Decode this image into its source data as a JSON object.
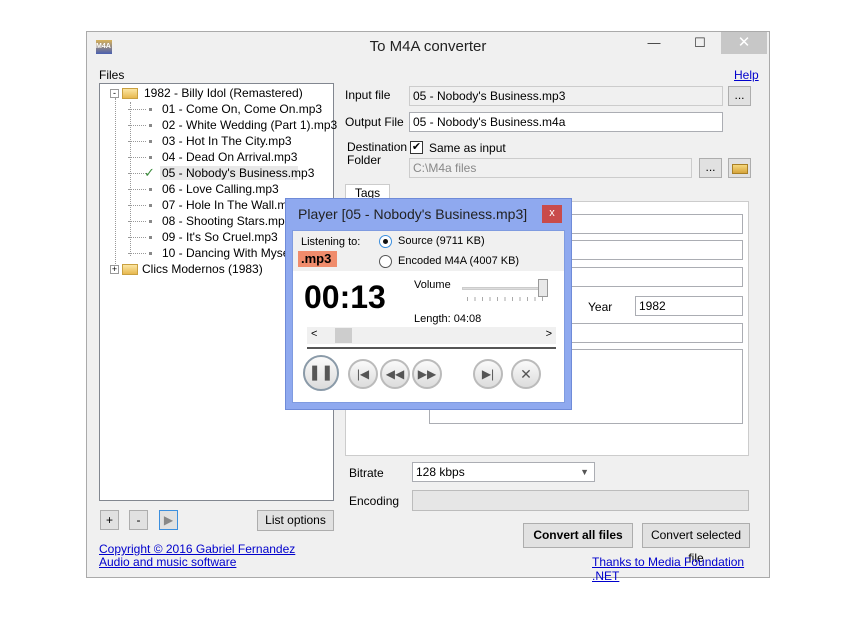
{
  "window": {
    "title": "To M4A converter",
    "minimize": "—",
    "maximize": "☐",
    "close": "✕"
  },
  "files_label": "Files",
  "help_link": "Help",
  "tree": {
    "albums": [
      {
        "label": "1982 - Billy Idol (Remastered)",
        "expanded": true,
        "tracks": [
          "01 - Come On, Come On.mp3",
          "02 - White Wedding (Part 1).mp3",
          "03 - Hot In The City.mp3",
          "04 - Dead On Arrival.mp3",
          "05 - Nobody's Business.mp3",
          "06 - Love Calling.mp3",
          "07 - Hole In The Wall.mp3",
          "08 - Shooting Stars.mp3",
          "09 - It's So Cruel.mp3",
          "10 - Dancing With Myself."
        ]
      },
      {
        "label": "Clics Modernos (1983)",
        "expanded": false
      }
    ],
    "selected_track": "05 - Nobody's Business.mp3"
  },
  "list_buttons": {
    "add": "+",
    "remove": "-",
    "play": "▶",
    "options": "List options"
  },
  "form": {
    "input_file_label": "Input file",
    "input_file": "05 - Nobody's Business.mp3",
    "output_file_label": "Output File",
    "output_file": "05 - Nobody's Business.m4a",
    "dest_label_1": "Destination",
    "dest_label_2": "Folder",
    "same_as_input_label": "Same as input",
    "same_as_input": true,
    "dest_folder": "C:\\M4a files",
    "browse": "...",
    "tags_tab": "Tags",
    "year_label": "Year",
    "year": "1982",
    "bitrate_label": "Bitrate",
    "bitrate": "128 kbps",
    "encoding_label": "Encoding",
    "encoding_progress": 0
  },
  "actions": {
    "convert_all": "Convert all files",
    "convert_selected": "Convert selected file"
  },
  "footer": {
    "copyright": "Copyright ©  2016 Gabriel Fernandez",
    "software": "Audio and music software",
    "thanks": "Thanks to Media Foundation .NET"
  },
  "player": {
    "title": "Player [05 - Nobody's Business.mp3]",
    "close": "x",
    "listening_label": "Listening to:",
    "format_badge": ".mp3",
    "source_label": "Source (9711 KB)",
    "encoded_label": "Encoded M4A (4007 KB)",
    "selected_source": "source",
    "time": "00:13",
    "volume_label": "Volume",
    "volume": 1.0,
    "length": "Length: 04:08",
    "position_fraction": 0.05,
    "scroll_left": "<",
    "scroll_right": ">",
    "badge_color": "#f08c6c"
  }
}
